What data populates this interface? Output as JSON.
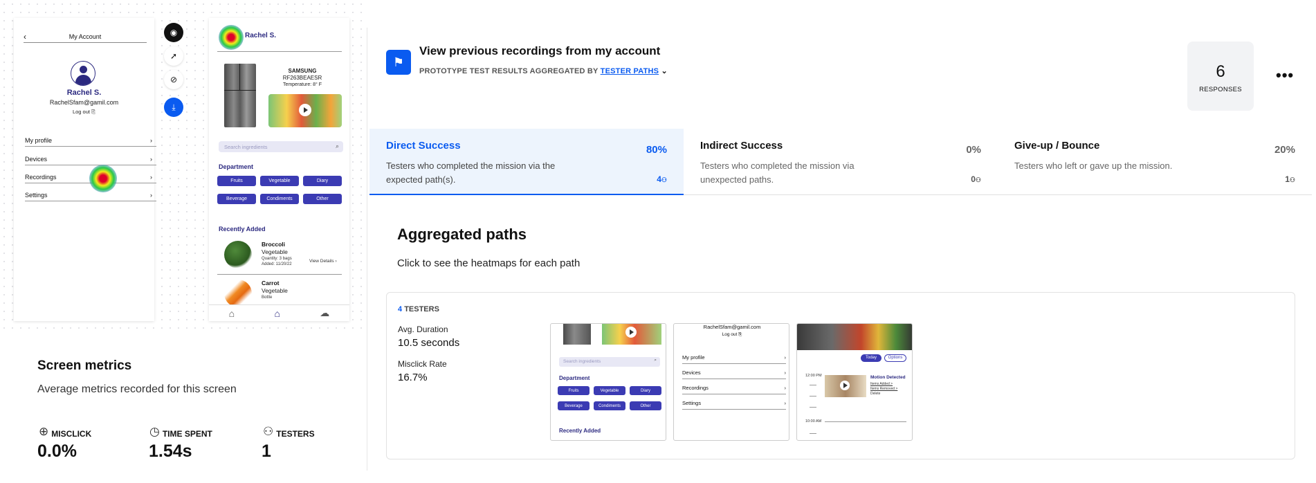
{
  "canvas": {
    "phone1": {
      "header_title": "My Account",
      "back_glyph": "‹",
      "user_name": "Rachel S.",
      "email": "RachelSfam@gamil.com",
      "logout": "Log out",
      "menu": [
        {
          "label": "My profile",
          "chevron": "›"
        },
        {
          "label": "Devices",
          "chevron": "›"
        },
        {
          "label": "Recordings",
          "chevron": "›"
        },
        {
          "label": "Settings",
          "chevron": "›"
        }
      ]
    },
    "toolbar": {
      "icons": [
        "heatmap-icon",
        "clicks-icon",
        "no-image-icon",
        "download-icon"
      ]
    },
    "phone2": {
      "user_name": "Rachel S.",
      "brand": "SAMSUNG",
      "model": "RF263BEAESR",
      "temperature": "Temperature: 8° F",
      "search_placeholder": "Search ingredients",
      "department_title": "Department",
      "chips": [
        "Fruits",
        "Vegetable",
        "Diary",
        "Beverage",
        "Condiments",
        "Other"
      ],
      "recently_added_title": "Recently Added",
      "items": [
        {
          "name": "Broccoli",
          "category": "Vegetable",
          "quantity": "Quantity: 3 bags",
          "added": "Added: 11/20/22",
          "details": "View Details ›"
        },
        {
          "name": "Carrot",
          "category": "Vegetable",
          "quantity": "Bottle",
          "added": "",
          "details": ""
        }
      ]
    }
  },
  "metrics": {
    "title": "Screen metrics",
    "subtitle": "Average metrics recorded for this screen",
    "items": [
      {
        "label": "MISCLICK",
        "value": "0.0%",
        "icon": "misclick-icon"
      },
      {
        "label": "TIME SPENT",
        "value": "1.54s",
        "icon": "clock-icon"
      },
      {
        "label": "TESTERS",
        "value": "1",
        "icon": "users-icon"
      }
    ]
  },
  "header": {
    "title": "View previous recordings from my account",
    "subtitle_prefix": "PROTOTYPE TEST RESULTS AGGREGATED BY",
    "subtitle_link": "TESTER PATHS",
    "responses_count": "6",
    "responses_label": "RESPONSES",
    "more": "•••"
  },
  "tabs": [
    {
      "title": "Direct Success",
      "percent": "80%",
      "desc": "Testers who completed the mission via the expected path(s).",
      "count": "4"
    },
    {
      "title": "Indirect Success",
      "percent": "0%",
      "desc": "Testers who completed the mission via unexpected paths.",
      "count": "0"
    },
    {
      "title": "Give-up / Bounce",
      "percent": "20%",
      "desc": "Testers who left or gave up the mission.",
      "count": "1"
    }
  ],
  "aggregated": {
    "title": "Aggregated paths",
    "subtitle": "Click to see the heatmaps for each path",
    "card": {
      "testers_count": "4",
      "testers_label": "TESTERS",
      "avg_duration_label": "Avg. Duration",
      "avg_duration_value": "10.5 seconds",
      "misclick_label": "Misclick Rate",
      "misclick_value": "16.7%",
      "thumb1": {
        "search": "Search ingredients",
        "department": "Department",
        "chips": [
          "Fruits",
          "Vegetable",
          "Diary",
          "Beverage",
          "Condiments",
          "Other"
        ],
        "recently": "Recently Added"
      },
      "thumb2": {
        "email": "RachelSfam@gamil.com",
        "logout": "Log out",
        "menu": [
          "My profile",
          "Devices",
          "Recordings",
          "Settings"
        ]
      },
      "thumb3": {
        "today": "Today",
        "options": "Options",
        "time1": "12:00 PM",
        "time2": "10:00 AM",
        "event_title": "Motion Detected",
        "event_l1": "Items Added >",
        "event_l2": "Items Removed >",
        "event_l3": "Delete"
      }
    }
  }
}
